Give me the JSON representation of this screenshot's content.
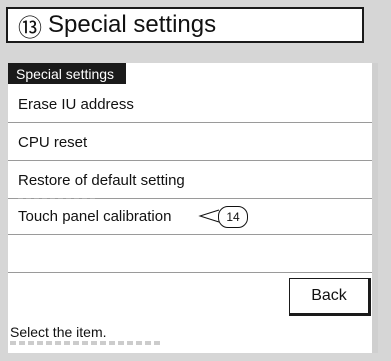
{
  "header": {
    "step_marker": "⑬",
    "title": "Special settings"
  },
  "section": {
    "label": "Special settings"
  },
  "menu": {
    "items": [
      {
        "label": "Erase IU address"
      },
      {
        "label": "CPU reset"
      },
      {
        "label": "Restore of default setting"
      },
      {
        "label": "Touch panel calibration"
      },
      {
        "label": ""
      }
    ]
  },
  "annotation": {
    "callout": "14"
  },
  "footer": {
    "back_label": "Back",
    "status_text": "Select the item."
  }
}
